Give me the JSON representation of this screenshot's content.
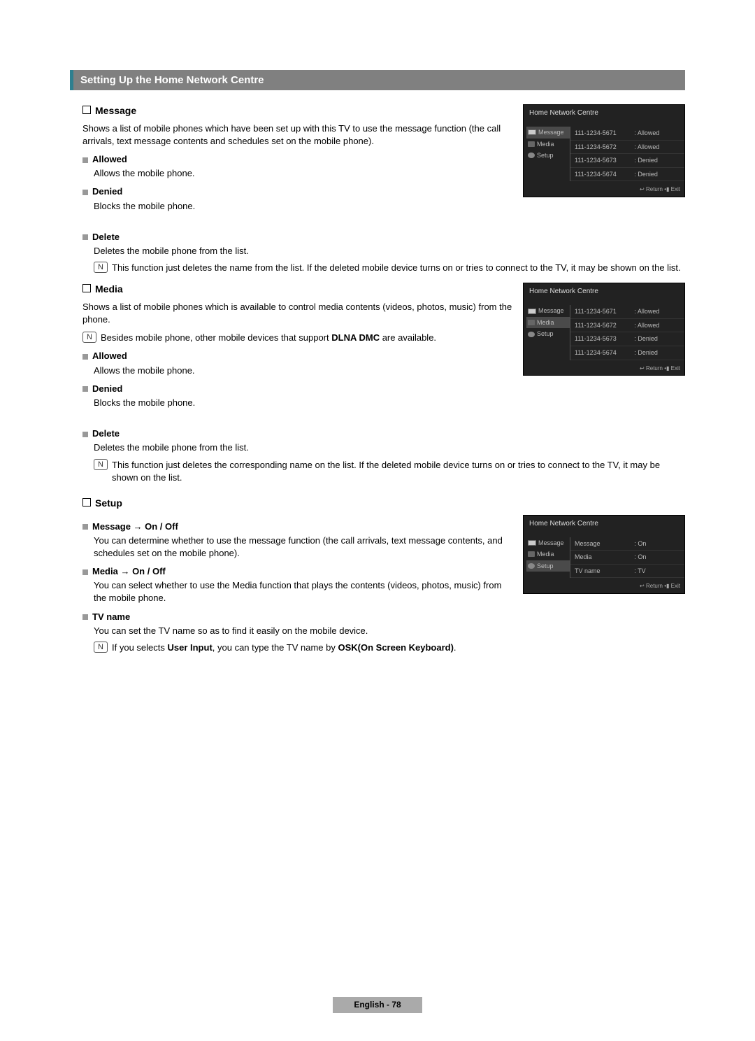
{
  "title": "Setting Up the Home Network Centre",
  "sections": {
    "message": {
      "heading": "Message",
      "desc": "Shows a list of mobile phones which have been set up with this TV to use the message function (the call arrivals, text message contents and schedules set on the mobile phone).",
      "allowed_h": "Allowed",
      "allowed_p": "Allows the mobile phone.",
      "denied_h": "Denied",
      "denied_p": "Blocks the mobile phone.",
      "delete_h": "Delete",
      "delete_p": "Deletes the mobile phone from the list.",
      "delete_note": "This function just deletes the name from the list. If the deleted mobile device turns on or tries to connect to the TV, it may be shown on the list."
    },
    "media": {
      "heading": "Media",
      "desc": "Shows a list of mobile phones which is available to control media contents (videos, photos, music) from the phone.",
      "note1_a": "Besides mobile phone, other mobile devices that support ",
      "note1_b": "DLNA DMC",
      "note1_c": " are available.",
      "allowed_h": "Allowed",
      "allowed_p": "Allows the mobile phone.",
      "denied_h": "Denied",
      "denied_p": "Blocks the mobile phone.",
      "delete_h": "Delete",
      "delete_p": "Deletes the mobile phone from the list.",
      "delete_note": "This function just deletes the corresponding name on the list. If the deleted mobile device turns on or tries to connect to the TV, it may be shown on the list."
    },
    "setup": {
      "heading": "Setup",
      "msg_h": "Message → On / Off",
      "msg_p": "You can determine whether to use the message function (the call arrivals, text message contents, and schedules set on the mobile phone).",
      "media_h": "Media → On / Off",
      "media_p": "You can select whether to use the Media function that plays the contents (videos, photos, music) from the mobile phone.",
      "tvn_h": "TV name",
      "tvn_p": "You can set the TV name so as to find it easily on the mobile device.",
      "tvn_note_a": "If you selects ",
      "tvn_note_b": "User Input",
      "tvn_note_c": ", you can type the TV name by ",
      "tvn_note_d": "OSK(On Screen Keyboard)",
      "tvn_note_e": "."
    }
  },
  "screens": {
    "title": "Home Network Centre",
    "side": {
      "message": "Message",
      "media": "Media",
      "setup": "Setup"
    },
    "devlist": [
      {
        "num": "111-1234-5671",
        "st": ": Allowed"
      },
      {
        "num": "111-1234-5672",
        "st": ": Allowed"
      },
      {
        "num": "111-1234-5673",
        "st": ": Denied"
      },
      {
        "num": "111-1234-5674",
        "st": ": Denied"
      }
    ],
    "setuprows": [
      {
        "k": "Message",
        "v": ": On"
      },
      {
        "k": "Media",
        "v": ": On"
      },
      {
        "k": "TV name",
        "v": ": TV"
      }
    ],
    "ret": "Return",
    "exit": "Exit"
  },
  "footer": {
    "lang": "English - ",
    "page": "78"
  },
  "note_glyph": "N"
}
